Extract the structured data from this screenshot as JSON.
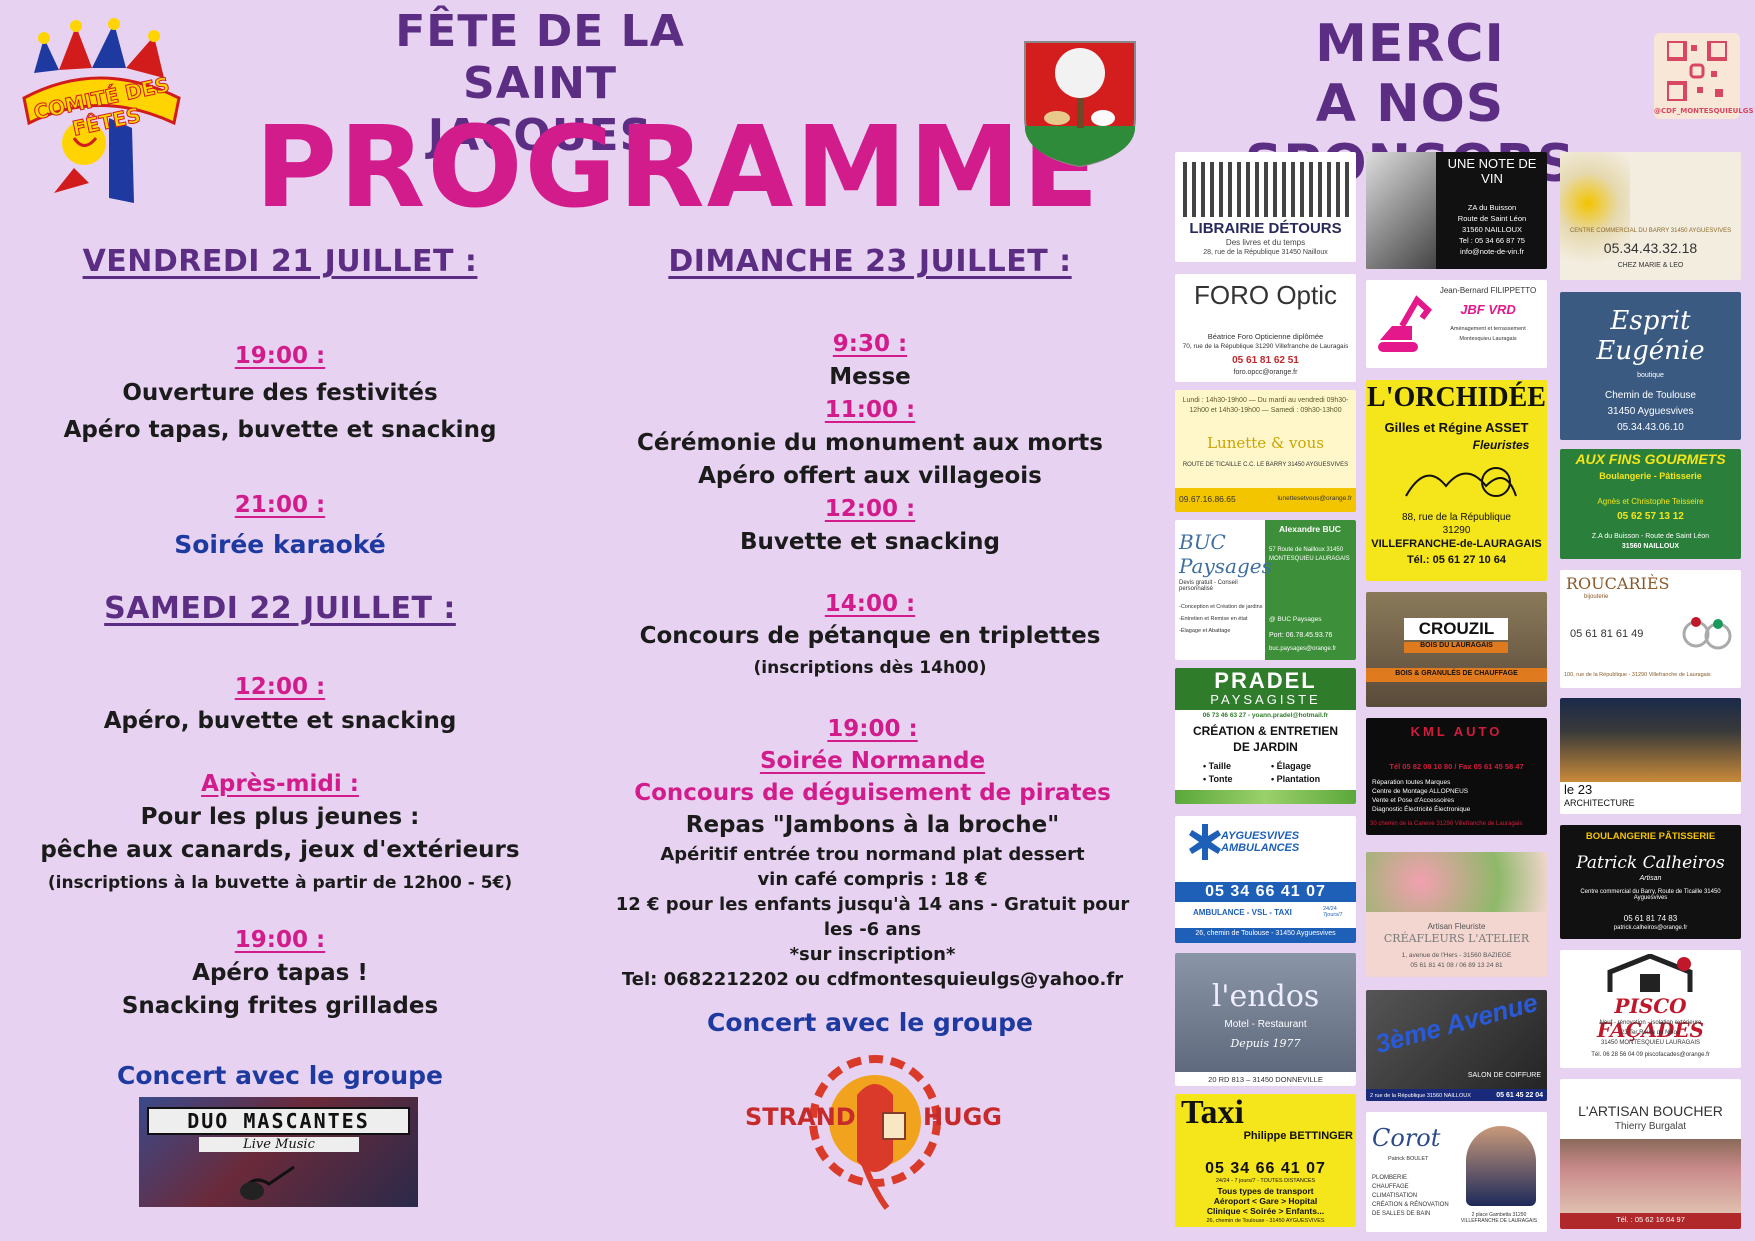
{
  "header": {
    "logo_text": "COMITÉ DES FÊTES",
    "fete_line1": "FÊTE DE LA",
    "fete_line2": "SAINT JACQUES",
    "programme": "PROGRAMME",
    "merci_line1": "MERCI",
    "merci_line2": "A NOS SPONSORS",
    "qr_handle": "@CDF_MONTESQUIEULGS"
  },
  "colors": {
    "background": "#e7d3f1",
    "purple": "#5b2d83",
    "pink": "#d21c8c",
    "blue": "#1e3aa0"
  },
  "friday": {
    "title": "VENDREDI 21 JUILLET :",
    "t1": "19:00 :",
    "l1": "Ouverture des festivités",
    "l2": "Apéro tapas, buvette et snacking",
    "t2": "21:00 :",
    "l3": "Soirée karaoké"
  },
  "saturday": {
    "title": "SAMEDI 22 JUILLET :",
    "t1": "12:00 :",
    "l1": "Apéro, buvette et snacking",
    "t2": "Après-midi :",
    "l2": "Pour les plus jeunes :",
    "l3": "pêche aux canards, jeux d'extérieurs",
    "l4": "(inscriptions à la buvette à partir de 12h00 - 5€)",
    "t3": "19:00 :",
    "l5": "Apéro tapas !",
    "l6": "Snacking frites grillades",
    "concert": "Concert avec le groupe",
    "band": "DUO MASCANTES",
    "band_sub": "Live Music"
  },
  "sunday": {
    "title": "DIMANCHE 23 JUILLET :",
    "t1": "9:30 :",
    "l1": "Messe",
    "t2": "11:00 :",
    "l2": "Cérémonie du monument aux morts",
    "l3": "Apéro offert aux villageois",
    "t3": "12:00 :",
    "l4": "Buvette et snacking",
    "t4": "14:00 :",
    "l5": "Concours de pétanque en triplettes",
    "l6": "(inscriptions dès 14h00)",
    "t5": "19:00 :",
    "l7": "Soirée Normande",
    "l8": "Concours de déguisement de pirates",
    "l9": "Repas  \"Jambons à la broche\"",
    "l10": "Apéritif entrée trou normand plat dessert",
    "l11": "vin café compris : 18 €",
    "l12": "12 € pour les enfants jusqu'à 14 ans - Gratuit pour les -6 ans",
    "l13": "*sur inscription*",
    "l14": "Tel: 0682212202 ou cdfmontesquieulgs@yahoo.fr",
    "concert": "Concert avec le groupe",
    "band_left": "STRAND",
    "band_right": "HUGG"
  },
  "sponsors": {
    "librairie": {
      "name": "LIBRAIRIE DÉTOURS",
      "sub": "Des livres et du temps",
      "addr": "28, rue de la République 31450 Nailloux"
    },
    "note_de_vin": {
      "name": "UNE NOTE DE VIN",
      "addr1": "ZA du Buisson",
      "addr2": "Route de Saint Léon",
      "addr3": "31560 NAILLOUX",
      "tel": "Tel : 05 34 66 87 75",
      "mail": "info@note-de-vin.fr"
    },
    "marie_leo": {
      "name": "CHEZ MARIE & LEO",
      "addr": "CENTRE COMMERCIAL DU BARRY 31450 AYGUESVIVES",
      "tel": "05.34.43.32.18"
    },
    "foro_optic": {
      "name": "FORO Optic",
      "l1": "Béatrice Foro  Opticienne diplômée",
      "l2": "70, rue de la République 31290 Villefranche de Lauragais",
      "tel": "05 61 81 62 51",
      "mail": "foro.opcc@orange.fr"
    },
    "jbf": {
      "owner": "Jean-Bernard FILIPPETTO",
      "name": "JBF VRD",
      "l1": "Aménagement et terrassement",
      "l2": "Montesquieu Lauragais"
    },
    "esprit": {
      "name": "Esprit Eugénie",
      "sub": "boutique",
      "addr1": "Chemin de Toulouse",
      "addr2": "31450 Ayguesvives",
      "tel": "05.34.43.06.10"
    },
    "lunette": {
      "name": "Lunette & vous",
      "hours": "Lundi : 14h30-19h00 — Du mardi au vendredi 09h30-12h00 et 14h30-19h00 — Samedi : 09h30-13h00",
      "addr": "ROUTE DE TICAILLE C.C. LE BARRY 31450 AYGUESVIVES",
      "tel": "09.67.16.86.65",
      "mail": "lunettesetvous@orange.fr"
    },
    "orchidee": {
      "name": "L'ORCHIDÉE",
      "owners": "Gilles et Régine ASSET",
      "role": "Fleuristes",
      "addr1": "88, rue de la République",
      "addr2": "31290",
      "addr3": "VILLEFRANCHE-de-LAURAGAIS",
      "tel": "Tél.: 05 61 27 10 64"
    },
    "fins_gourmets": {
      "name": "AUX FINS GOURMETS",
      "sub": "Boulangerie - Pâtisserie",
      "owners": "Agnès et Christophe Teisseire",
      "tel": "05 62 57 13 12",
      "addr1": "Z.A du Buisson - Route de Saint Léon",
      "addr2": "31560 NAILLOUX"
    },
    "buc": {
      "name": "BUC Paysages",
      "owner": "Alexandre BUC",
      "addr": "57 Route de Nailloux 31450 MONTESQUIEU LAURAGAIS",
      "l1": "Devis gratuit - Conseil personnalisé",
      "l2": "-Conception et Création de jardins",
      "l3": "-Entretien et Remise en état",
      "l4": "-Élagage et Abattage",
      "fb": "@ BUC Paysages",
      "port": "Port: 06.78.45.93.76",
      "mail": "buc.paysages@orange.fr"
    },
    "crouzil": {
      "name": "CROUZIL",
      "sub": "BOIS DU LAURAGAIS",
      "l1": "BOIS & GRANULÉS DE CHAUFFAGE"
    },
    "roucaries": {
      "name": "ROUCARIÈS",
      "sub": "bijouterie",
      "tel": "05 61 81 61 49",
      "addr": "100, rue de la République - 31290 Villefranche de Lauragais"
    },
    "pradel": {
      "name": "PRADEL",
      "sub": "PAYSAGISTE",
      "contact": "06 73 46 63 27 - yoann.pradel@hotmail.fr",
      "l1": "CRÉATION & ENTRETIEN",
      "l2": "DE JARDIN",
      "s1": "• Taille",
      "s2": "• Élagage",
      "s3": "• Tonte",
      "s4": "• Plantation"
    },
    "kml": {
      "name": "KML AUTO",
      "tel": "Tél 05 82 08 10 80 / Fax 05 61 45 58 47",
      "l1": "Réparation toutes Marques",
      "l2": "Centre de Montage ALLOPNEUS",
      "l3": "Vente et Pose d'Accessoires",
      "l4": "Diagnostic Électricité Électronique",
      "addr": "30 chemin de la Caneve 31290 Villefranche de Lauragais"
    },
    "le23": {
      "name": "le 23",
      "sub": "ARCHITECTURE"
    },
    "ambulances": {
      "name": "AYGUESVIVES AMBULANCES",
      "tel": "05 34 66 41 07",
      "l1": "AMBULANCE - VSL - TAXI",
      "l2": "24/24 7jours/7",
      "addr": "26, chemin de Toulouse - 31450 Ayguesvives"
    },
    "creafleurs": {
      "name": "CRÉAFLEURS L'ATELIER",
      "sub": "Artisan Fleuriste",
      "addr": "1, avenue de l'Hers - 31560 BAZIEGE",
      "tel": "05 61 81 41 08 / 06 89 13 24 81"
    },
    "calheiros": {
      "l1": "BOULANGERIE  PÂTISSERIE",
      "name": "Patrick Calheiros",
      "sub": "Artisan",
      "addr": "Centre commercial du Barry, Route de Ticaille 31450 Ayguesvives",
      "tel": "05 61 81 74 83",
      "mail": "patrick.calheiros@orange.fr"
    },
    "pendos": {
      "name": "l'endos",
      "sub": "Motel - Restaurant",
      "since": "Depuis 1977",
      "addr": "20 RD 813 – 31450 DONNEVILLE"
    },
    "3eme_avenue": {
      "name": "3ème Avenue",
      "sub": "SALON DE COIFFURE",
      "addr": "2 rue de la République 31560 NAILLOUX",
      "tel": "05 61 45 22 04"
    },
    "pisco": {
      "name": "PISCO FAÇADES",
      "l1": "Neuf - rénovation - isolation extérieure",
      "addr1": "23 Ter Route de Nillou",
      "addr2": "31450 MONTESQUIEU LAURAGAIS",
      "tel": "Tél. 06 28 56 04 09 piscofacades@orange.fr"
    },
    "taxi": {
      "name": "Taxi",
      "owner": "Philippe BETTINGER",
      "tel": "05 34 66 41 07",
      "l1": "24/24 - 7 jours/7 - TOUTES DISTANCES",
      "l2": "Tous types de transport",
      "l3": "Aéroport < Gare > Hopital",
      "l4": "Clinique < Soirée > Enfants...",
      "addr": "26, chemin de Toulouse - 31450 AYGUESVIVES"
    },
    "corot": {
      "name": "Corot",
      "owner": "Patrick BOULET",
      "l1": "PLOMBERIE",
      "l2": "CHAUFFAGE",
      "l3": "CLIMATISATION",
      "l4": "CRÉATION & RÉNOVATION DE SALLES DE BAIN",
      "addr": "2 place Gambetta 31290 VILLEFRANCHE DE LAURAGAIS"
    },
    "boucher": {
      "name": "L'ARTISAN BOUCHER",
      "owner": "Thierry Burgalat",
      "tel": "Tél. : 05 62 16 04 97"
    }
  }
}
